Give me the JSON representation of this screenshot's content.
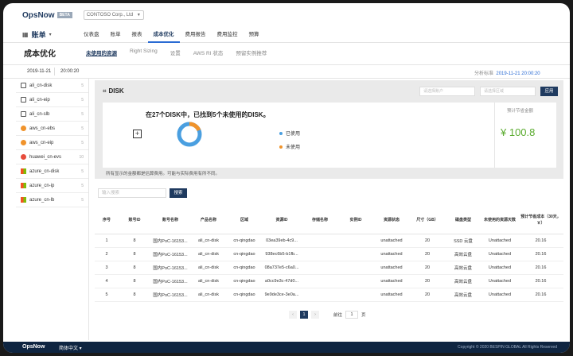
{
  "brand": {
    "name": "OpsNow",
    "tag": "BETA"
  },
  "org": {
    "value": "CONTOSO Corp., Ltd"
  },
  "section": {
    "title": "账单"
  },
  "nav": [
    "仪表盘",
    "账单",
    "报表",
    "成本优化",
    "费用报告",
    "费用监控",
    "预算"
  ],
  "nav_active": 3,
  "page": {
    "title": "成本优化",
    "tabs": [
      "未使用的资源",
      "Right Sizing",
      "设置",
      "AWS RI 状态",
      "预留实例推荐"
    ]
  },
  "dates": {
    "date": "2019-11-21",
    "time": "20:00:20",
    "analysis_label": "分析标准",
    "analysis_value": "2019-11-21 20:00:20"
  },
  "sidebar": [
    {
      "label": "ali_cn-disk",
      "count": "5",
      "icon": "box-icon"
    },
    {
      "label": "ali_cn-eip",
      "count": "5",
      "icon": "box-icon"
    },
    {
      "label": "ali_cn-slb",
      "count": "5",
      "icon": "box-icon"
    },
    {
      "label": "aws_cn-ebs",
      "count": "5",
      "icon": "aws-icon"
    },
    {
      "label": "aws_cn-eip",
      "count": "5",
      "icon": "aws-icon"
    },
    {
      "label": "huawei_cn-evs",
      "count": "10",
      "icon": "huawei-icon"
    },
    {
      "label": "azure_cn-disk",
      "count": "5",
      "icon": "azure-icon"
    },
    {
      "label": "azure_cn-ip",
      "count": "5",
      "icon": "azure-icon"
    },
    {
      "label": "azure_cn-lb",
      "count": "5",
      "icon": "azure-icon"
    }
  ],
  "panel": {
    "service": "DISK",
    "account_placeholder": "请选择账户",
    "region_placeholder": "请选择区域",
    "apply": "应用",
    "summary": "在27个DISK中，已找到5个未使用的DISK。",
    "legend_used": "已使用",
    "legend_unused": "未使用",
    "used": 22,
    "unused": 5,
    "used_color": "#4a9fe0",
    "unused_color": "#f0932b",
    "est_label": "预计节省金额",
    "est_value": "¥ 100.8",
    "note": "所有显示的金额都是估算费用。可能与实际费用有所不同。"
  },
  "search": {
    "placeholder": "输入搜索",
    "button": "搜索"
  },
  "table": {
    "headers": [
      "序号",
      "账号ID",
      "账号名称",
      "产品名称",
      "区域",
      "资源ID",
      "存储名称",
      "实例ID",
      "资源状态",
      "尺寸（GB）",
      "磁盘类型",
      "未使用的资源天数",
      "预计节省成本（30天，￥）"
    ],
    "rows": [
      [
        "1",
        "8",
        "国内PoC-16153...",
        "ali_cn-disk",
        "cn-qingdao",
        "03ea39eb-4c9...",
        "",
        "",
        "unattached",
        "20",
        "SSD 云盘",
        "Unattached",
        "20.16"
      ],
      [
        "2",
        "8",
        "国内PoC-16153...",
        "ali_cn-disk",
        "cn-qingdao",
        "938ec6b5-b1fb...",
        "",
        "",
        "unattached",
        "20",
        "高效云盘",
        "Unattached",
        "20.16"
      ],
      [
        "3",
        "8",
        "国内PoC-16153...",
        "ali_cn-disk",
        "cn-qingdao",
        "08a737e5-c6a0...",
        "",
        "",
        "unattached",
        "20",
        "高效云盘",
        "Unattached",
        "20.16"
      ],
      [
        "4",
        "8",
        "国内PoC-16153...",
        "ali_cn-disk",
        "cn-qingdao",
        "a0cc9e3c-47d0...",
        "",
        "",
        "unattached",
        "20",
        "高效云盘",
        "Unattached",
        "20.16"
      ],
      [
        "5",
        "8",
        "国内PoC-16153...",
        "ali_cn-disk",
        "cn-qingdao",
        "9e9de3ce-3e0a...",
        "",
        "",
        "unattached",
        "20",
        "高效云盘",
        "Unattached",
        "20.16"
      ]
    ]
  },
  "pager": {
    "current": "1",
    "goto": "前往",
    "goto_value": "1",
    "page_unit": "页"
  },
  "footer": {
    "brand": "OpsNow",
    "lang": "简体中文 ▾",
    "copyright": "Copyright © 2020 BESPIN GLOBAL All Rights Reserved"
  }
}
